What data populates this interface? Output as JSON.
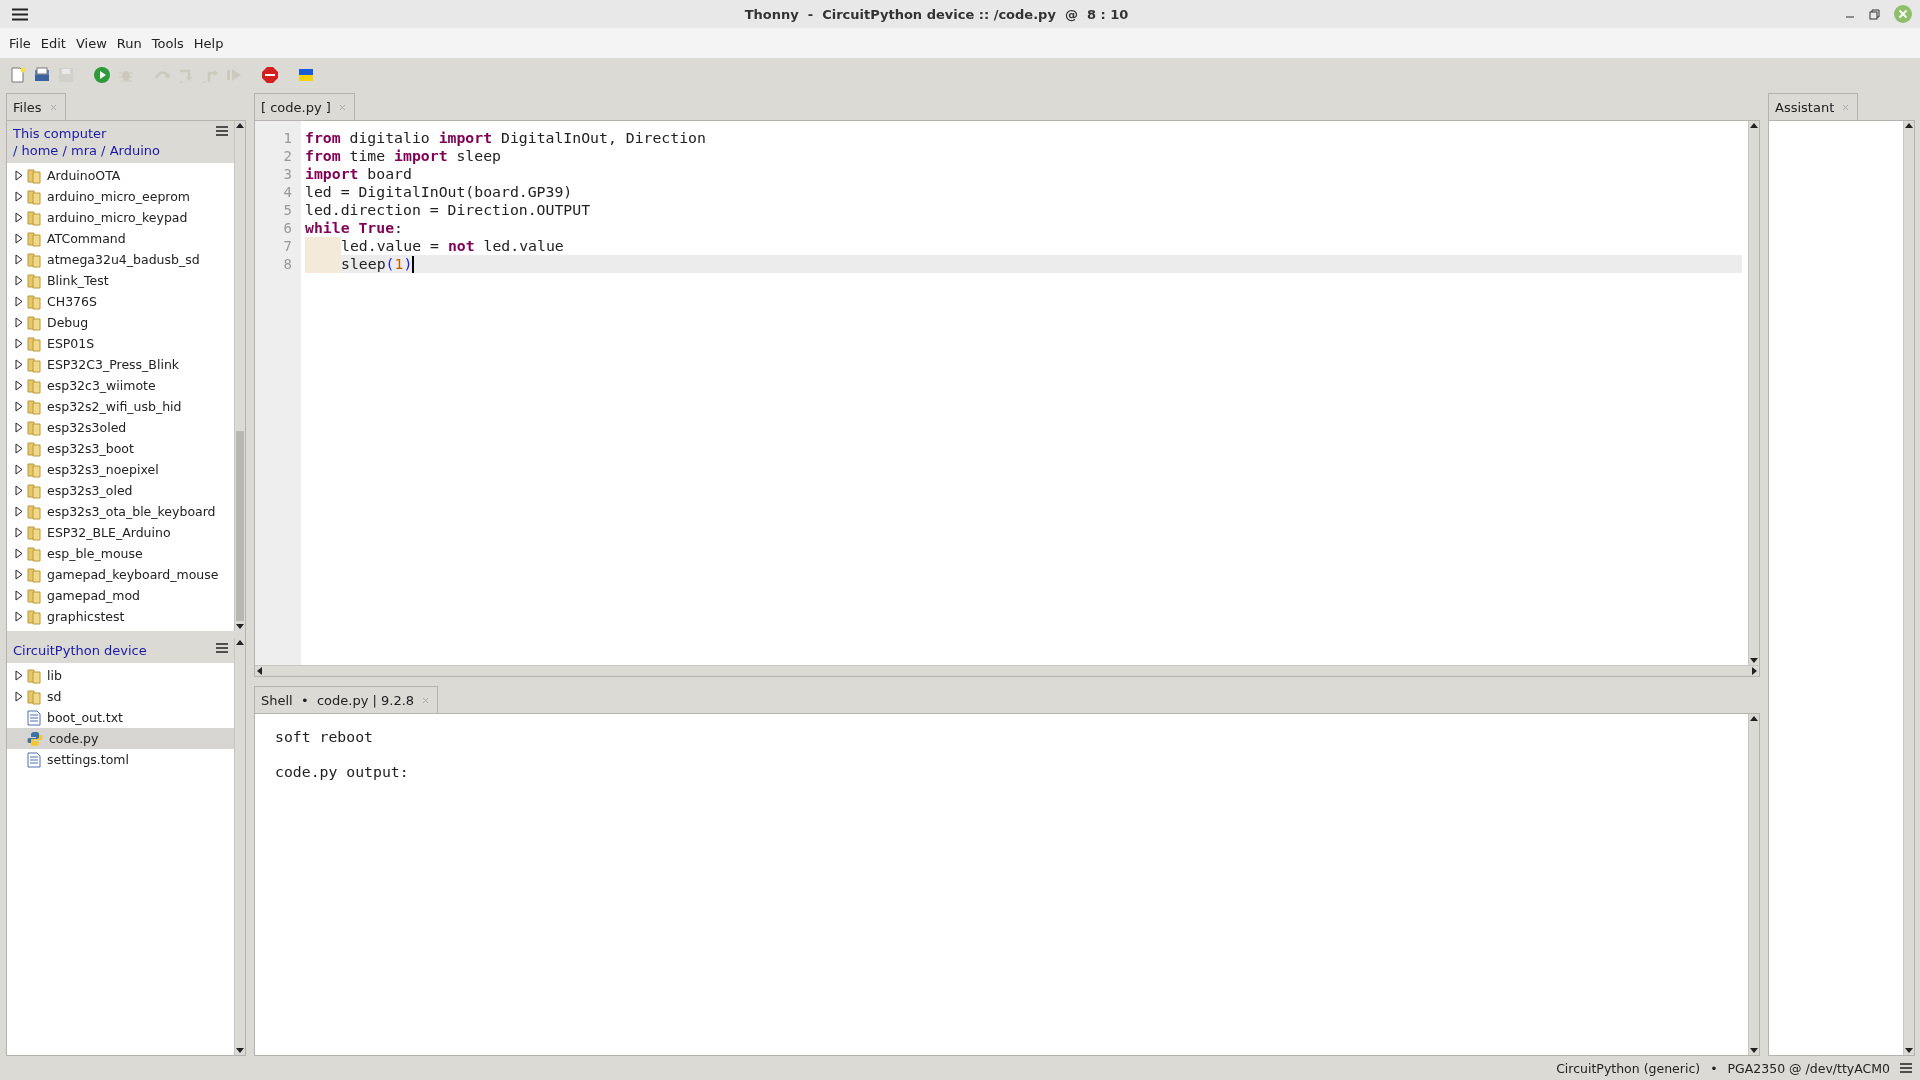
{
  "window": {
    "title": "Thonny  -  CircuitPython device :: /code.py  @  8 : 10"
  },
  "menu": [
    "File",
    "Edit",
    "View",
    "Run",
    "Tools",
    "Help"
  ],
  "toolbar": [
    {
      "kind": "new",
      "disabled": false
    },
    {
      "kind": "open",
      "disabled": false
    },
    {
      "kind": "save",
      "disabled": true
    },
    {
      "kind": "run",
      "disabled": false
    },
    {
      "kind": "debug",
      "disabled": true
    },
    {
      "kind": "step_over",
      "disabled": true
    },
    {
      "kind": "step_into",
      "disabled": true
    },
    {
      "kind": "step_out",
      "disabled": true
    },
    {
      "kind": "resume",
      "disabled": true
    },
    {
      "kind": "stop",
      "disabled": false
    },
    {
      "kind": "flag",
      "disabled": false
    }
  ],
  "files_panel": {
    "tab": "Files",
    "local": {
      "title": "This computer",
      "path": "/ home / mra / Arduino",
      "items": [
        {
          "name": "ArduinoOTA",
          "kind": "folder",
          "selected": false
        },
        {
          "name": "arduino_micro_eeprom",
          "kind": "folder",
          "selected": false
        },
        {
          "name": "arduino_micro_keypad",
          "kind": "folder",
          "selected": false
        },
        {
          "name": "ATCommand",
          "kind": "folder",
          "selected": false
        },
        {
          "name": "atmega32u4_badusb_sd",
          "kind": "folder",
          "selected": false
        },
        {
          "name": "Blink_Test",
          "kind": "folder",
          "selected": false
        },
        {
          "name": "CH376S",
          "kind": "folder",
          "selected": false
        },
        {
          "name": "Debug",
          "kind": "folder",
          "selected": false
        },
        {
          "name": "ESP01S",
          "kind": "folder",
          "selected": false
        },
        {
          "name": "ESP32C3_Press_Blink",
          "kind": "folder",
          "selected": false
        },
        {
          "name": "esp32c3_wiimote",
          "kind": "folder",
          "selected": false
        },
        {
          "name": "esp32s2_wifi_usb_hid",
          "kind": "folder",
          "selected": false
        },
        {
          "name": "esp32s3oled",
          "kind": "folder",
          "selected": false
        },
        {
          "name": "esp32s3_boot",
          "kind": "folder",
          "selected": false
        },
        {
          "name": "esp32s3_noepixel",
          "kind": "folder",
          "selected": false
        },
        {
          "name": "esp32s3_oled",
          "kind": "folder",
          "selected": false
        },
        {
          "name": "esp32s3_ota_ble_keyboard",
          "kind": "folder",
          "selected": false
        },
        {
          "name": "ESP32_BLE_Arduino",
          "kind": "folder",
          "selected": false
        },
        {
          "name": "esp_ble_mouse",
          "kind": "folder",
          "selected": false
        },
        {
          "name": "gamepad_keyboard_mouse",
          "kind": "folder",
          "selected": false
        },
        {
          "name": "gamepad_mod",
          "kind": "folder",
          "selected": false
        },
        {
          "name": "graphicstest",
          "kind": "folder",
          "selected": false
        }
      ]
    },
    "device": {
      "title": "CircuitPython device",
      "items": [
        {
          "name": "lib",
          "kind": "folder",
          "selected": false
        },
        {
          "name": "sd",
          "kind": "folder",
          "selected": false
        },
        {
          "name": "boot_out.txt",
          "kind": "text",
          "selected": false
        },
        {
          "name": "code.py",
          "kind": "python",
          "selected": true
        },
        {
          "name": "settings.toml",
          "kind": "text",
          "selected": false
        }
      ]
    }
  },
  "editor": {
    "tab": "[ code.py ]",
    "lines": [
      {
        "number": "1",
        "indented": false,
        "current": false,
        "cursor": false,
        "tokens": [
          {
            "kind": "keyword",
            "text": "from"
          },
          {
            "kind": "name",
            "text": " digitalio "
          },
          {
            "kind": "keyword",
            "text": "import"
          },
          {
            "kind": "name",
            "text": " DigitalInOut, Direction"
          }
        ]
      },
      {
        "number": "2",
        "indented": false,
        "current": false,
        "cursor": false,
        "tokens": [
          {
            "kind": "keyword",
            "text": "from"
          },
          {
            "kind": "name",
            "text": " time "
          },
          {
            "kind": "keyword",
            "text": "import"
          },
          {
            "kind": "name",
            "text": " sleep"
          }
        ]
      },
      {
        "number": "3",
        "indented": false,
        "current": false,
        "cursor": false,
        "tokens": [
          {
            "kind": "keyword",
            "text": "import"
          },
          {
            "kind": "name",
            "text": " board"
          }
        ]
      },
      {
        "number": "4",
        "indented": false,
        "current": false,
        "cursor": false,
        "tokens": [
          {
            "kind": "name",
            "text": "led = DigitalInOut(board.GP39)"
          }
        ]
      },
      {
        "number": "5",
        "indented": false,
        "current": false,
        "cursor": false,
        "tokens": [
          {
            "kind": "name",
            "text": "led.direction = Direction.OUTPUT"
          }
        ]
      },
      {
        "number": "6",
        "indented": false,
        "current": false,
        "cursor": false,
        "tokens": [
          {
            "kind": "keyword",
            "text": "while True"
          },
          {
            "kind": "name",
            "text": ":"
          }
        ]
      },
      {
        "number": "7",
        "indented": true,
        "current": false,
        "cursor": false,
        "tokens": [
          {
            "kind": "name",
            "text": "led.value = "
          },
          {
            "kind": "keyword",
            "text": "not"
          },
          {
            "kind": "name",
            "text": " led.value"
          }
        ]
      },
      {
        "number": "8",
        "indented": true,
        "current": true,
        "cursor": true,
        "tokens": [
          {
            "kind": "name",
            "text": "sleep"
          },
          {
            "kind": "bracket",
            "text": "("
          },
          {
            "kind": "number",
            "text": "1"
          },
          {
            "kind": "bracket",
            "text": ")"
          }
        ]
      }
    ]
  },
  "shell": {
    "tab": "Shell  •  code.py | 9.2.8",
    "lines": [
      "soft reboot",
      "code.py output:"
    ]
  },
  "assistant": {
    "tab": "Assistant"
  },
  "status_bar": {
    "interpreter": "CircuitPython (generic)",
    "separator": "•",
    "port": "PGA2350 @ /dev/ttyACM0"
  }
}
